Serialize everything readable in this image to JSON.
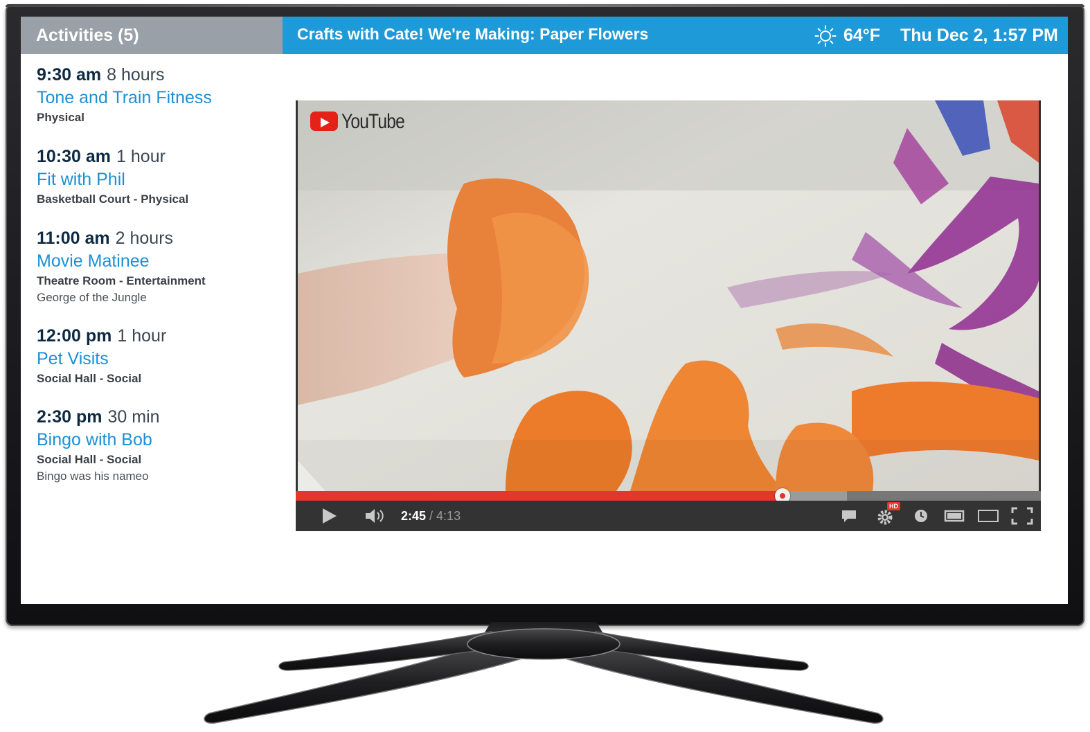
{
  "sidebar": {
    "header": "Activities (5)",
    "activities": [
      {
        "time": "9:30 am",
        "duration": "8 hours",
        "title": "Tone and Train Fitness",
        "meta": "Physical",
        "note": ""
      },
      {
        "time": "10:30 am",
        "duration": "1 hour",
        "title": "Fit with Phil",
        "meta": "Basketball Court - Physical",
        "note": ""
      },
      {
        "time": "11:00 am",
        "duration": "2 hours",
        "title": "Movie Matinee",
        "meta": "Theatre Room - Entertainment",
        "note": "George of the Jungle"
      },
      {
        "time": "12:00 pm",
        "duration": "1 hour",
        "title": "Pet Visits",
        "meta": "Social Hall - Social",
        "note": ""
      },
      {
        "time": "2:30 pm",
        "duration": "30 min",
        "title": "Bingo with Bob",
        "meta": "Social Hall - Social",
        "note": "Bingo was his nameo"
      }
    ]
  },
  "banner": {
    "title": "Crafts with Cate!  We're Making: Paper Flowers",
    "weather_icon": "sun-icon",
    "temperature": "64°F",
    "datetime": "Thu Dec 2, 1:57 PM"
  },
  "player": {
    "logo_text": "YouTube",
    "current_time": "2:45",
    "separator": " / ",
    "total_time": "4:13",
    "progress": 0.653,
    "hd_badge": "HD",
    "controls": [
      "play-icon",
      "volume-icon",
      "captions-icon",
      "settings-icon",
      "watch-later-icon",
      "miniplayer-icon",
      "theater-mode-icon",
      "fullscreen-icon"
    ]
  },
  "colors": {
    "banner": "#1f9ad8",
    "sidebar_header": "#9aa0a8",
    "activity_title": "#1b90d4",
    "activity_time": "#0e2a42",
    "progress_played": "#e5362c"
  }
}
